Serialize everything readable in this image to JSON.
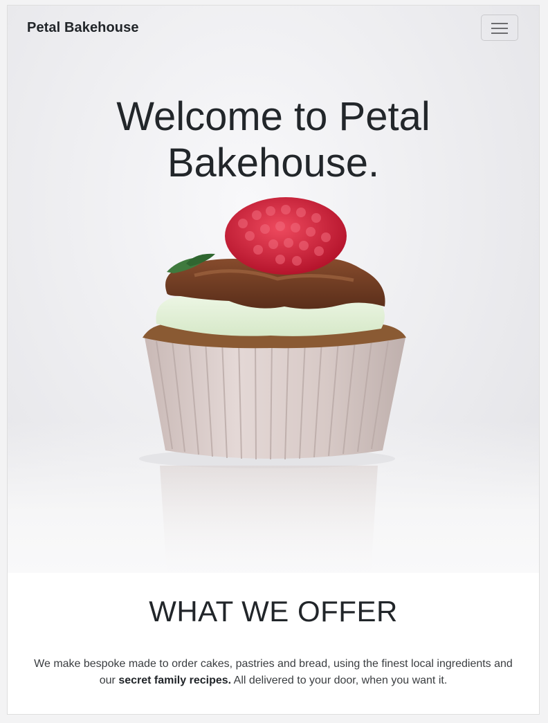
{
  "navbar": {
    "brand": "Petal Bakehouse",
    "toggle_icon": "hamburger-menu-icon"
  },
  "hero": {
    "title": "Welcome to Petal Bakehouse.",
    "image": "cupcake-with-raspberry"
  },
  "offer": {
    "title": "WHAT WE OFFER",
    "text_before": "We make bespoke made to order cakes, pastries and bread, using the finest local ingredients and our ",
    "text_bold": "secret family recipes.",
    "text_after": " All delivered to your door, when you want it."
  },
  "colors": {
    "text": "#212529",
    "hero_bg": "#ececef",
    "raspberry": "#d8283f",
    "chocolate": "#6b3a22",
    "cream": "#e3f1d9",
    "wrapper": "#dccfcd"
  }
}
